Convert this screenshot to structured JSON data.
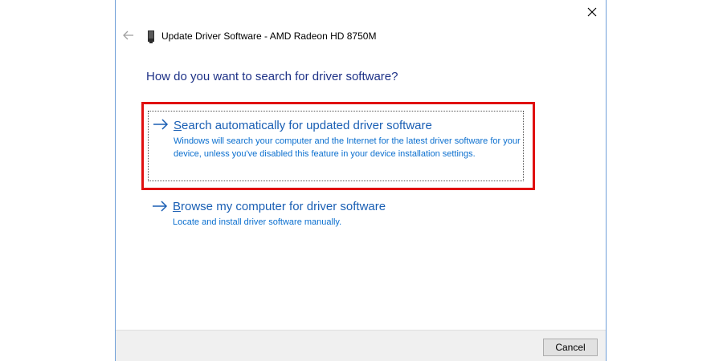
{
  "window": {
    "title": "Update Driver Software - AMD Radeon HD 8750M",
    "close_icon": "close-icon",
    "back_icon": "back-arrow-icon",
    "device_icon": "device-icon"
  },
  "main": {
    "question": "How do you want to search for driver software?",
    "options": [
      {
        "title_accel": "S",
        "title_rest": "earch automatically for updated driver software",
        "description": "Windows will search your computer and the Internet for the latest driver software for your device, unless you've disabled this feature in your device installation settings.",
        "icon": "arrow-right-icon",
        "focused": true,
        "highlighted": true
      },
      {
        "title_accel": "B",
        "title_rest": "rowse my computer for driver software",
        "description": "Locate and install driver software manually.",
        "icon": "arrow-right-icon",
        "focused": false,
        "highlighted": false
      }
    ]
  },
  "footer": {
    "cancel_label": "Cancel"
  },
  "colors": {
    "title_blue": "#1e3287",
    "link_blue": "#1a5fb4",
    "highlight_red": "#e01010"
  }
}
